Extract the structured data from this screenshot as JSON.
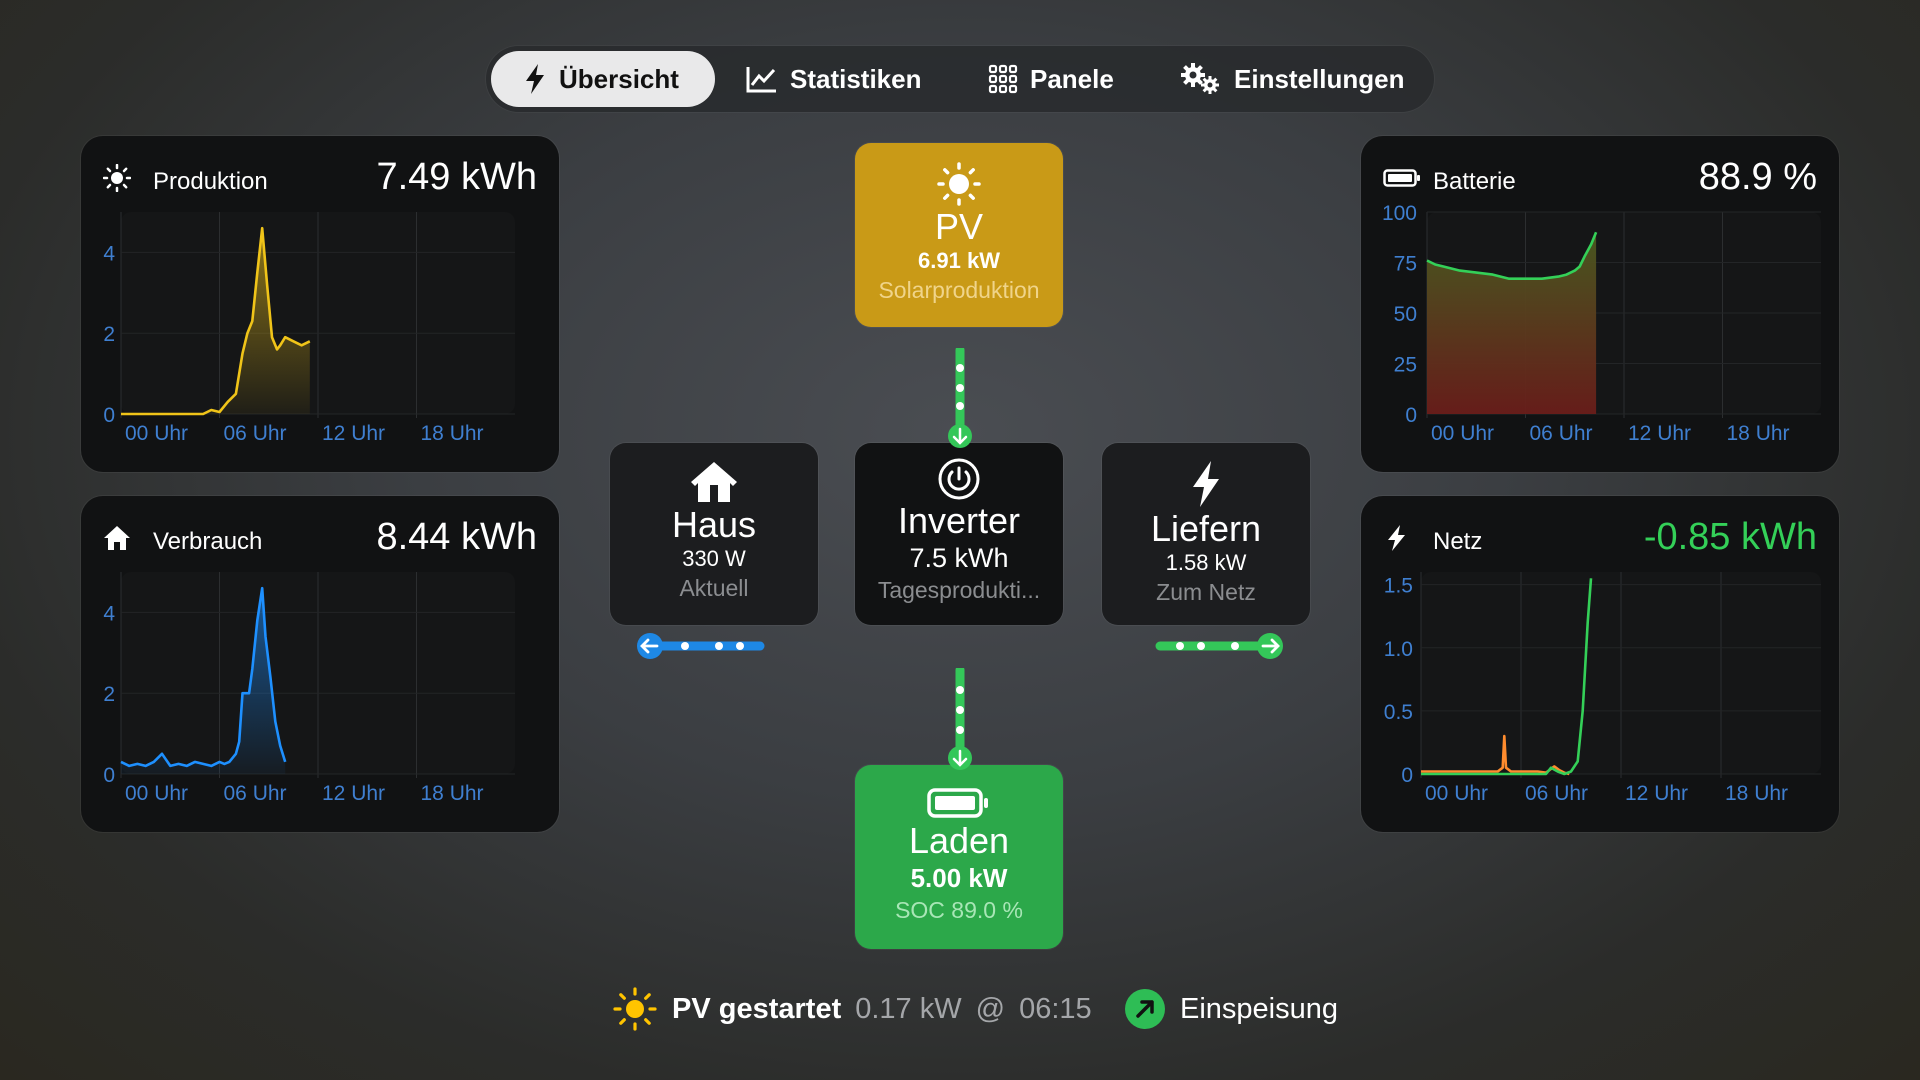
{
  "nav": {
    "tabs": [
      {
        "label": "Übersicht",
        "icon": "bolt-icon",
        "active": true
      },
      {
        "label": "Statistiken",
        "icon": "chart-line-icon",
        "active": false
      },
      {
        "label": "Panele",
        "icon": "grid-icon",
        "active": false
      },
      {
        "label": "Einstellungen",
        "icon": "gears-icon",
        "active": false
      }
    ]
  },
  "cards": {
    "produktion": {
      "title": "Produktion",
      "value": "7.49 kWh",
      "icon": "sun-icon"
    },
    "verbrauch": {
      "title": "Verbrauch",
      "value": "8.44 kWh",
      "icon": "house-icon"
    },
    "batterie": {
      "title": "Batterie",
      "value": "88.9 %",
      "icon": "battery-icon"
    },
    "netz": {
      "title": "Netz",
      "value": "-0.85 kWh",
      "icon": "bolt-icon",
      "value_color": "#34d058"
    }
  },
  "flow": {
    "pv": {
      "title": "PV",
      "value": "6.91 kW",
      "sub": "Solarproduktion",
      "color": "#c99a17"
    },
    "inverter": {
      "title": "Inverter",
      "value": "7.5 kWh",
      "sub": "Tagesprodukti..."
    },
    "haus": {
      "title": "Haus",
      "value": "330 W",
      "sub": "Aktuell"
    },
    "liefern": {
      "title": "Liefern",
      "value": "1.58 kW",
      "sub": "Zum Netz"
    },
    "battery": {
      "title": "Laden",
      "value": "5.00 kW",
      "sub": "SOC 89.0 %",
      "color": "#2ca84a"
    }
  },
  "status": {
    "pv_label": "PV gestartet",
    "pv_detail": "0.17 kW",
    "at": "@",
    "time": "06:15",
    "feed_label": "Einspeisung"
  },
  "chart_data": [
    {
      "id": "produktion",
      "type": "area",
      "color": "#f0c419",
      "x_ticks": [
        "00 Uhr",
        "06 Uhr",
        "12 Uhr",
        "18 Uhr"
      ],
      "y_ticks": [
        "0",
        "2",
        "4"
      ],
      "ylim": [
        0,
        5
      ],
      "xlim": [
        0,
        24
      ],
      "x": [
        0.0,
        3.0,
        5.0,
        5.5,
        6.0,
        6.5,
        7.0,
        7.4,
        7.7,
        8.0,
        8.3,
        8.6,
        8.9,
        9.2,
        9.5,
        9.7,
        10.0,
        10.5,
        11.0,
        11.5
      ],
      "y": [
        0.0,
        0.0,
        0.0,
        0.1,
        0.05,
        0.3,
        0.5,
        1.5,
        2.0,
        2.3,
        3.5,
        4.6,
        3.2,
        1.9,
        1.6,
        1.7,
        1.9,
        1.8,
        1.7,
        1.8
      ]
    },
    {
      "id": "verbrauch",
      "type": "area",
      "color": "#1e90ff",
      "x_ticks": [
        "00 Uhr",
        "06 Uhr",
        "12 Uhr",
        "18 Uhr"
      ],
      "y_ticks": [
        "0",
        "2",
        "4"
      ],
      "ylim": [
        0,
        5
      ],
      "xlim": [
        0,
        24
      ],
      "x": [
        0.0,
        0.5,
        1.0,
        1.5,
        2.0,
        2.5,
        3.0,
        3.5,
        4.0,
        4.5,
        5.0,
        5.5,
        6.0,
        6.3,
        6.6,
        7.0,
        7.2,
        7.4,
        7.8,
        8.0,
        8.3,
        8.6,
        8.8,
        9.1,
        9.4,
        9.7,
        10.0
      ],
      "y": [
        0.3,
        0.2,
        0.25,
        0.2,
        0.3,
        0.5,
        0.2,
        0.25,
        0.2,
        0.3,
        0.25,
        0.2,
        0.3,
        0.25,
        0.3,
        0.5,
        0.8,
        2.0,
        2.0,
        2.6,
        3.8,
        4.6,
        3.4,
        2.4,
        1.3,
        0.7,
        0.3
      ]
    },
    {
      "id": "batterie",
      "type": "area",
      "color": "#34d058",
      "x_ticks": [
        "00 Uhr",
        "06 Uhr",
        "12 Uhr",
        "18 Uhr"
      ],
      "y_ticks": [
        "0",
        "25",
        "50",
        "75",
        "100"
      ],
      "ylim": [
        0,
        100
      ],
      "xlim": [
        0,
        24
      ],
      "x": [
        0.0,
        0.5,
        1.0,
        2.0,
        3.0,
        4.0,
        5.0,
        6.0,
        7.0,
        8.0,
        8.5,
        9.0,
        9.3,
        9.6,
        10.0,
        10.3
      ],
      "y": [
        76,
        74,
        73,
        71,
        70,
        69,
        67,
        67,
        67,
        68,
        69,
        71,
        73,
        78,
        84,
        90
      ]
    },
    {
      "id": "netz",
      "type": "line",
      "x_ticks": [
        "00 Uhr",
        "06 Uhr",
        "12 Uhr",
        "18 Uhr"
      ],
      "y_ticks": [
        "0",
        "0.5",
        "1.0",
        "1.5"
      ],
      "ylim": [
        0,
        1.6
      ],
      "xlim": [
        0,
        24
      ],
      "series": [
        {
          "color": "#ff8c2e",
          "x": [
            0.0,
            4.0,
            4.6,
            4.9,
            5.0,
            5.1,
            5.4,
            6.0,
            7.0,
            7.5,
            7.8,
            8.0,
            8.3,
            8.6,
            8.9
          ],
          "y": [
            0.02,
            0.02,
            0.02,
            0.05,
            0.3,
            0.05,
            0.02,
            0.02,
            0.02,
            0.01,
            0.04,
            0.06,
            0.03,
            0.01,
            0.0
          ]
        },
        {
          "color": "#34d058",
          "x": [
            0.0,
            7.0,
            7.5,
            7.8,
            8.2,
            8.6,
            9.0,
            9.4,
            9.7,
            10.0,
            10.2
          ],
          "y": [
            0.0,
            0.0,
            0.0,
            0.05,
            0.02,
            0.0,
            0.02,
            0.1,
            0.5,
            1.2,
            1.55
          ]
        }
      ]
    }
  ]
}
